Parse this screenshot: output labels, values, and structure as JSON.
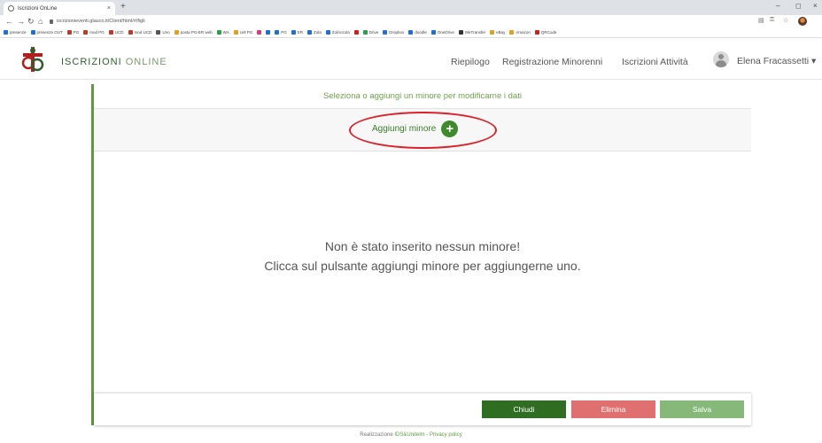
{
  "browser": {
    "tab_title": "Iscrizioni OnLine",
    "tab_close": "×",
    "new_tab": "+",
    "url": "iscrizionieventi.glauco.it/Client/html/#/figli",
    "window_min": "–",
    "window_max": "◻",
    "window_close": "×",
    "bookmarks": [
      {
        "label": "presenze",
        "color": "#1e6fd0"
      },
      {
        "label": "presenze OUT",
        "color": "#1e6fd0"
      },
      {
        "label": "PG",
        "color": "#c0392b"
      },
      {
        "label": "mod PG",
        "color": "#c0392b"
      },
      {
        "label": "UCD",
        "color": "#c0392b"
      },
      {
        "label": "mod UCD",
        "color": "#c0392b"
      },
      {
        "label": "Uno",
        "color": "#555555"
      },
      {
        "label": "posta PG-ER web",
        "color": "#e0a020"
      },
      {
        "label": "WA",
        "color": "#25a244"
      },
      {
        "label": "cell PG",
        "color": "#e0a020"
      },
      {
        "label": "",
        "color": "#d93a7a"
      },
      {
        "label": "",
        "color": "#1e6fd0"
      },
      {
        "label": "PG",
        "color": "#1e6fd0"
      },
      {
        "label": "ER",
        "color": "#1e6fd0"
      },
      {
        "label": "Zola",
        "color": "#1e6fd0"
      },
      {
        "label": "ZolAnzola",
        "color": "#1e6fd0"
      },
      {
        "label": "",
        "color": "#d02020"
      },
      {
        "label": "Drive",
        "color": "#2aa14a"
      },
      {
        "label": "Dropbox",
        "color": "#2a6fd0"
      },
      {
        "label": "doodle",
        "color": "#1e6fd0"
      },
      {
        "label": "OneDrive",
        "color": "#1e6fd0"
      },
      {
        "label": "WeTransfer",
        "color": "#333333"
      },
      {
        "label": "eBay",
        "color": "#e0a020"
      },
      {
        "label": "Amazon",
        "color": "#e0a020"
      },
      {
        "label": "QRCode",
        "color": "#d02020"
      }
    ]
  },
  "app": {
    "brand_bold": "ISCRIZIONI",
    "brand_light": " ONLINE",
    "nav": {
      "riepilogo": "Riepilogo",
      "registrazione": "Registrazione Minorenni",
      "attivita": "Iscrizioni Attività"
    },
    "user_name": "Elena Fracassetti ▾"
  },
  "panel": {
    "title": "Seleziona o aggiungi un minore per modificarne i dati",
    "add_label": "Aggiungi minore",
    "add_icon": "+",
    "empty_line1": "Non è stato inserito nessun minore!",
    "empty_line2": "Clicca sul pulsante aggiungi minore per aggiungerne uno.",
    "buttons": {
      "chiudi": "Chiudi",
      "elimina": "Elimina",
      "salva": "Salva"
    }
  },
  "credits": {
    "prefix": "Realizzazione ",
    "company": "IDS&Unitelm",
    "separator": " - ",
    "privacy": "Privacy policy"
  },
  "colors": {
    "accent_green": "#5f9a40",
    "dark_green": "#2f6e22",
    "delete_red": "#e07070",
    "save_green": "#86b87a",
    "annotation_red": "#d9232b"
  }
}
